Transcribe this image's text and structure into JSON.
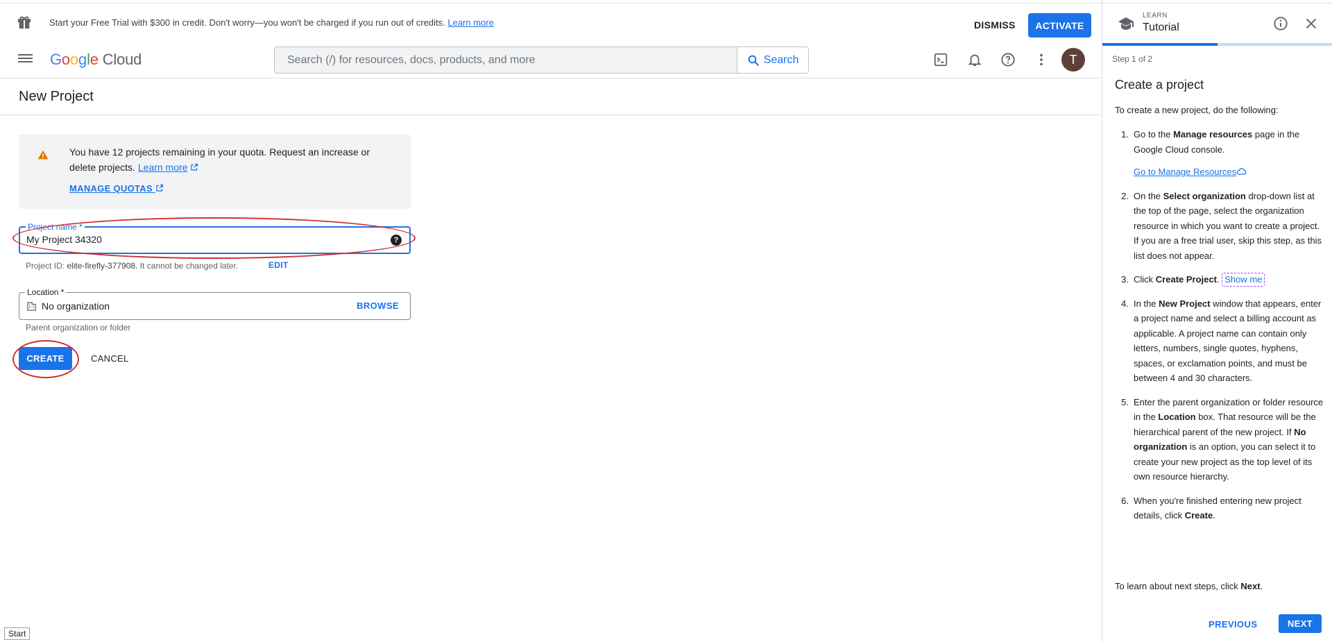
{
  "banner": {
    "text": "Start your Free Trial with $300 in credit. Don't worry—you won't be charged if you run out of credits.",
    "learn_more": "Learn more",
    "dismiss": "DISMISS",
    "activate": "ACTIVATE"
  },
  "header": {
    "logo_google": [
      "G",
      "o",
      "o",
      "g",
      "l",
      "e"
    ],
    "logo_cloud": "Cloud",
    "search_placeholder": "Search (/) for resources, docs, products, and more",
    "search_button": "Search",
    "avatar_initial": "T"
  },
  "page": {
    "title": "New Project",
    "quota_text": "You have 12 projects remaining in your quota. Request an increase or delete projects.",
    "quota_learn_more": "Learn more",
    "manage_quotas": "MANAGE QUOTAS",
    "project_name_label": "Project name *",
    "project_name_value": "My Project 34320",
    "project_id_prefix": "Project ID:",
    "project_id": "elite-firefly-377908.",
    "project_id_suffix": "It cannot be changed later.",
    "edit": "EDIT",
    "location_label": "Location *",
    "location_value": "No organization",
    "browse": "BROWSE",
    "location_help": "Parent organization or folder",
    "create": "CREATE",
    "cancel": "CANCEL",
    "start_tag": "Start"
  },
  "tutorial": {
    "learn_label": "LEARN",
    "title": "Tutorial",
    "progress": 0.5,
    "step_label": "Step 1 of 2",
    "heading": "Create a project",
    "intro": "To create a new project, do the following:",
    "steps": [
      {
        "num": "1.",
        "a": "Go to the ",
        "b": "Manage resources",
        "c": " page in the Google Cloud console.",
        "link": "Go to Manage Resources"
      },
      {
        "num": "2.",
        "a": "On the ",
        "b": "Select organization",
        "c": " drop-down list at the top of the page, select the organization resource in which you want to create a project. If you are a free trial user, skip this step, as this list does not appear."
      },
      {
        "num": "3.",
        "a": "Click ",
        "b": "Create Project",
        "c": ".",
        "show_me": "Show me"
      },
      {
        "num": "4.",
        "a": "In the ",
        "b": "New Project",
        "c": " window that appears, enter a project name and select a billing account as applicable. A project name can contain only letters, numbers, single quotes, hyphens, spaces, or exclamation points, and must be between 4 and 30 characters."
      },
      {
        "num": "5.",
        "a": "Enter the parent organization or folder resource in the ",
        "b": "Location",
        "c": " box. That resource will be the hierarchical parent of the new project. If ",
        "d": "No organization",
        "e": " is an option, you can select it to create your new project as the top level of its own resource hierarchy."
      },
      {
        "num": "6.",
        "a": "When you're finished entering new project details, click ",
        "b": "Create",
        "c": "."
      }
    ],
    "outro_a": "To learn about next steps, click ",
    "outro_b": "Next",
    "outro_c": ".",
    "previous": "PREVIOUS",
    "next": "NEXT"
  },
  "colors": {
    "accent": "#1a73e8",
    "annotation": "#d32f2f",
    "avatar": "#5d4037",
    "warning": "#e37400"
  },
  "icons": [
    "gift-icon",
    "menu-icon",
    "search-icon",
    "terminal-icon",
    "bell-icon",
    "help-icon",
    "more-vert-icon",
    "warning-icon",
    "external-link-icon",
    "help-filled-icon",
    "building-icon",
    "graduation-cap-icon",
    "info-icon",
    "close-icon",
    "cloud-icon"
  ]
}
